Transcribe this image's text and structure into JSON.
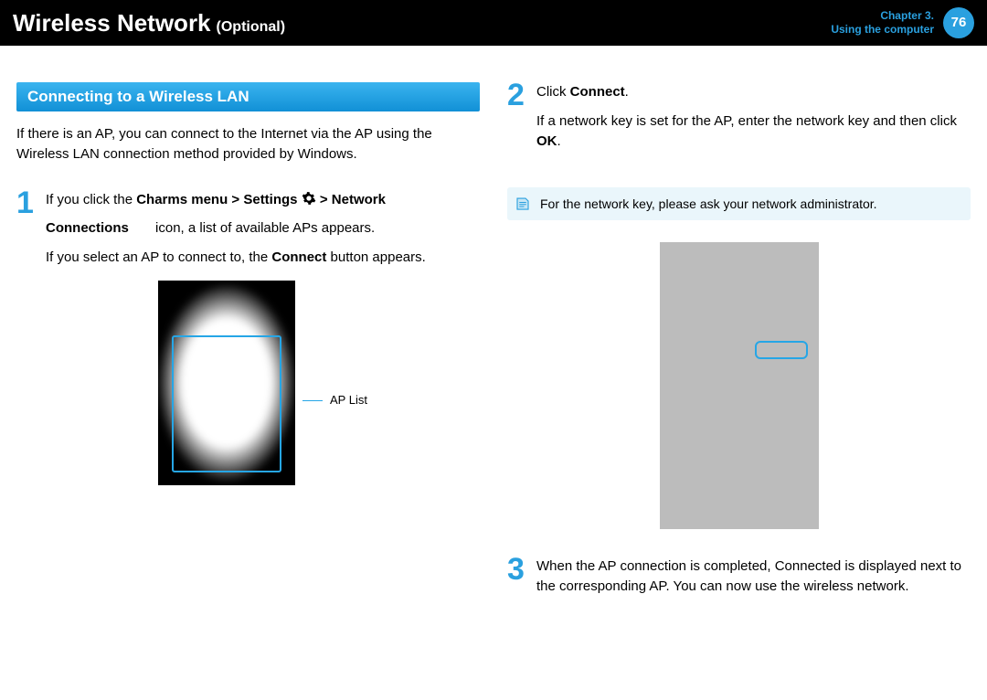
{
  "header": {
    "title_main": "Wireless Network",
    "title_optional": "(Optional)",
    "chapter_line1": "Chapter 3.",
    "chapter_line2": "Using the computer",
    "page_number": "76"
  },
  "section": {
    "title": "Connecting to a Wireless LAN",
    "intro": "If there is an AP, you can connect to the Internet via the AP using the Wireless LAN connection method provided by Windows."
  },
  "steps": {
    "one": {
      "num": "1",
      "line1_a": "If you click the ",
      "line1_b_bold": "Charms menu > Settings ",
      "line1_c_bold": " > Network",
      "line2_a_bold": "Connections",
      "line2_b": " icon, a list of available APs appears.",
      "line3_a": "If you select an AP to connect to, the ",
      "line3_b_bold": "Connect",
      "line3_c": " button appears.",
      "ap_label": "AP List"
    },
    "two": {
      "num": "2",
      "line1_a": "Click ",
      "line1_b_bold": "Connect",
      "line1_c": ".",
      "line2_a": "If a network key is set for the AP, enter the network key and then click ",
      "line2_b_bold": "OK",
      "line2_c": ".",
      "note": "For the network key, please ask your network administrator."
    },
    "three": {
      "num": "3",
      "text": "When the AP connection is completed, Connected is displayed next to the corresponding AP. You can now use the wireless network."
    }
  }
}
